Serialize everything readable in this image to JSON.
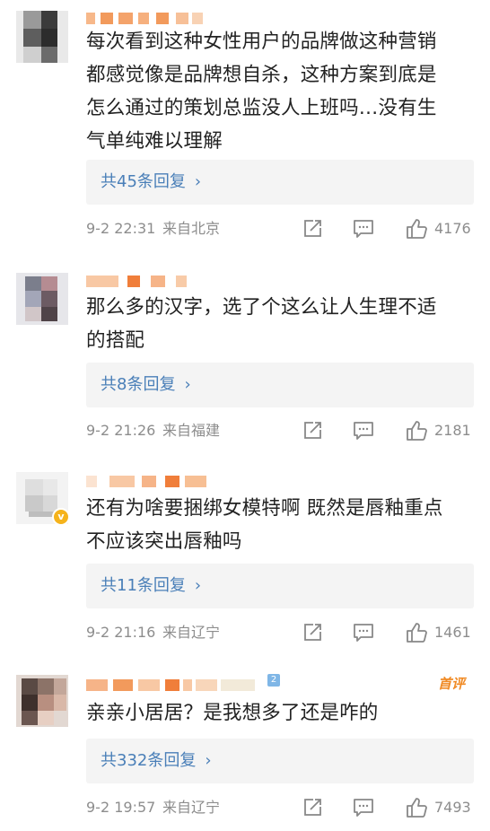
{
  "comments": [
    {
      "text_lines": [
        "每次看到这种女性用户的品牌做这种营销",
        "都感觉像是品牌想自杀，这种方案到底是",
        "怎么通过的策划总监没人上班吗…没有生",
        "气单纯难以理解"
      ],
      "reply_label": "共45条回复",
      "time": "9-2 22:31",
      "location": "来自北京",
      "likes": "4176",
      "icons": {
        "share": "share-icon",
        "comment": "comment-icon",
        "like": "thumbs-up-icon"
      }
    },
    {
      "text_lines": [
        "那么多的汉字，选了个这么让人生理不适",
        "的搭配"
      ],
      "reply_label": "共8条回复",
      "time": "9-2 21:26",
      "location": "来自福建",
      "likes": "2181",
      "icons": {
        "share": "share-icon",
        "comment": "comment-icon",
        "like": "thumbs-up-icon"
      }
    },
    {
      "text_lines": [
        "还有为啥要捆绑女模特啊 既然是唇釉重点",
        "不应该突出唇釉吗"
      ],
      "reply_label": "共11条回复",
      "time": "9-2 21:16",
      "location": "来自辽宁",
      "likes": "1461",
      "verified_mark": "v",
      "icons": {
        "share": "share-icon",
        "comment": "comment-icon",
        "like": "thumbs-up-icon"
      }
    },
    {
      "text_lines": [
        "亲亲小居居？是我想多了还是咋的"
      ],
      "reply_label": "共332条回复",
      "time": "9-2 19:57",
      "location": "来自辽宁",
      "likes": "7493",
      "badge": "首评",
      "level": "2",
      "icons": {
        "share": "share-icon",
        "comment": "comment-icon",
        "like": "thumbs-up-icon"
      }
    }
  ],
  "reply_chevron": "›",
  "colors": {
    "reply_link": "#4a7fb8",
    "meta_gray": "#8d8d8d",
    "reply_bg": "#f4f4f4",
    "badge_orange": "#f08a24",
    "name_blur": "#f4a36b"
  }
}
